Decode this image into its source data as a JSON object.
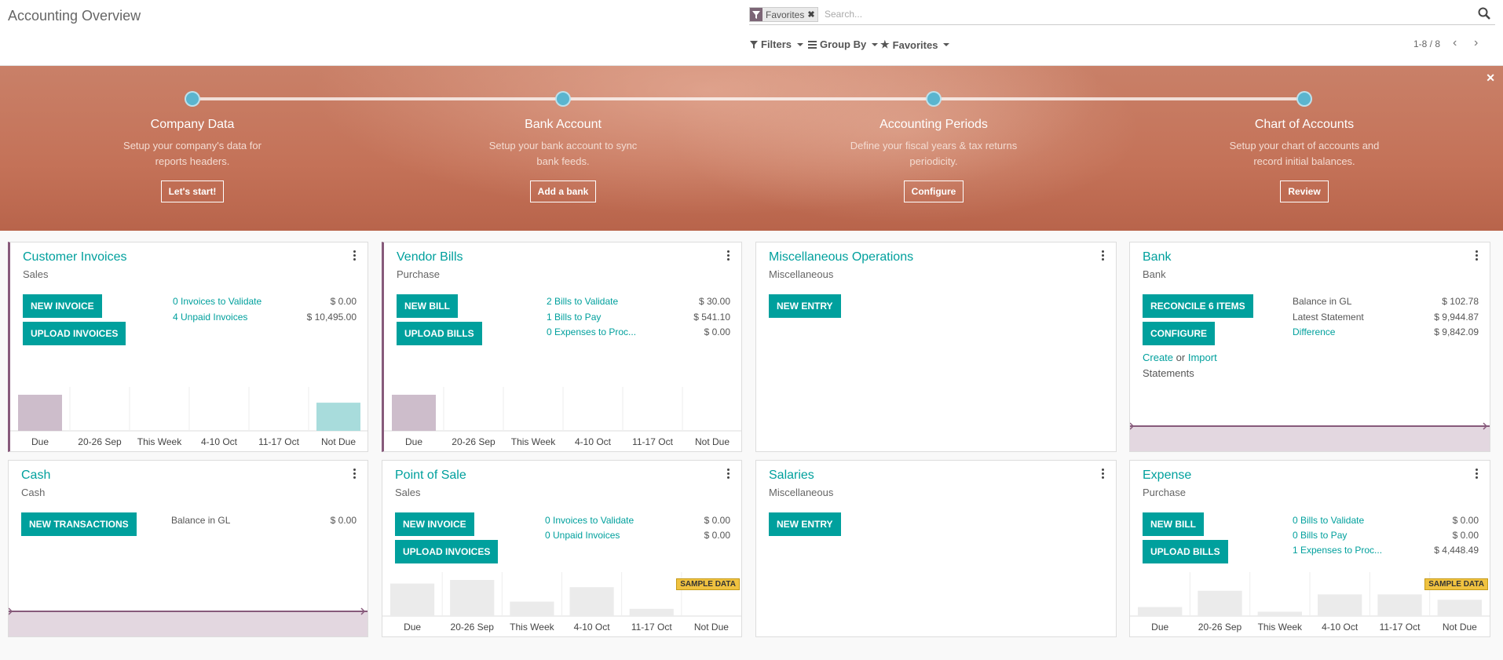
{
  "header": {
    "title": "Accounting Overview",
    "facet_label": "Favorites",
    "search_placeholder": "Search...",
    "filters": "Filters",
    "group_by": "Group By",
    "favorites": "Favorites",
    "pager": "1-8 / 8"
  },
  "onboarding": {
    "steps": [
      {
        "title": "Company Data",
        "desc": "Setup your company's data for reports headers.",
        "button": "Let's start!"
      },
      {
        "title": "Bank Account",
        "desc": "Setup your bank account to sync bank feeds.",
        "button": "Add a bank"
      },
      {
        "title": "Accounting Periods",
        "desc": "Define your fiscal years & tax returns periodicity.",
        "button": "Configure"
      },
      {
        "title": "Chart of Accounts",
        "desc": "Setup your chart of accounts and record initial balances.",
        "button": "Review"
      }
    ]
  },
  "cards": {
    "customer_invoices": {
      "title": "Customer Invoices",
      "subtitle": "Sales",
      "btn1": "NEW INVOICE",
      "btn2": "UPLOAD INVOICES",
      "row1_label": "0 Invoices to Validate",
      "row1_value": "$ 0.00",
      "row2_label": "4 Unpaid Invoices",
      "row2_value": "$ 10,495.00"
    },
    "vendor_bills": {
      "title": "Vendor Bills",
      "subtitle": "Purchase",
      "btn1": "NEW BILL",
      "btn2": "UPLOAD BILLS",
      "row1_label": "2 Bills to Validate",
      "row1_value": "$ 30.00",
      "row2_label": "1 Bills to Pay",
      "row2_value": "$ 541.10",
      "row3_label": "0 Expenses to Proc...",
      "row3_value": "$ 0.00"
    },
    "misc": {
      "title": "Miscellaneous Operations",
      "subtitle": "Miscellaneous",
      "btn1": "NEW ENTRY"
    },
    "bank": {
      "title": "Bank",
      "subtitle": "Bank",
      "btn1": "RECONCILE 6 ITEMS",
      "btn2": "CONFIGURE",
      "row1_label": "Balance in GL",
      "row1_value": "$ 102.78",
      "row2_label": "Latest Statement",
      "row2_value": "$ 9,944.87",
      "row3_label": "Difference",
      "row3_value": "$ 9,842.09",
      "create": "Create",
      "or": "or",
      "import": "Import",
      "statements": "Statements"
    },
    "cash": {
      "title": "Cash",
      "subtitle": "Cash",
      "btn1": "NEW TRANSACTIONS",
      "row1_label": "Balance in GL",
      "row1_value": "$ 0.00"
    },
    "pos": {
      "title": "Point of Sale",
      "subtitle": "Sales",
      "btn1": "NEW INVOICE",
      "btn2": "UPLOAD INVOICES",
      "row1_label": "0 Invoices to Validate",
      "row1_value": "$ 0.00",
      "row2_label": "0 Unpaid Invoices",
      "row2_value": "$ 0.00",
      "sample": "SAMPLE DATA"
    },
    "salaries": {
      "title": "Salaries",
      "subtitle": "Miscellaneous",
      "btn1": "NEW ENTRY"
    },
    "expense": {
      "title": "Expense",
      "subtitle": "Purchase",
      "btn1": "NEW BILL",
      "btn2": "UPLOAD BILLS",
      "row1_label": "0 Bills to Validate",
      "row1_value": "$ 0.00",
      "row2_label": "0 Bills to Pay",
      "row2_value": "$ 0.00",
      "row3_label": "1 Expenses to Proc...",
      "row3_value": "$ 4,448.49",
      "sample": "SAMPLE DATA"
    }
  },
  "chart_data": [
    {
      "type": "bar",
      "card": "customer_invoices",
      "categories": [
        "Due",
        "20-26 Sep",
        "This Week",
        "4-10 Oct",
        "11-17 Oct",
        "Not Due"
      ],
      "values": [
        1.0,
        0,
        0,
        0,
        0,
        0.78
      ],
      "colors": [
        "#cdbdcb",
        "#cdbdcb",
        "#cdbdcb",
        "#cdbdcb",
        "#cdbdcb",
        "#a8dcdc"
      ]
    },
    {
      "type": "bar",
      "card": "vendor_bills",
      "categories": [
        "Due",
        "20-26 Sep",
        "This Week",
        "4-10 Oct",
        "11-17 Oct",
        "Not Due"
      ],
      "values": [
        1.0,
        0,
        0,
        0,
        0,
        0
      ],
      "colors": [
        "#cdbdcb",
        "#cdbdcb",
        "#cdbdcb",
        "#cdbdcb",
        "#cdbdcb",
        "#a8dcdc"
      ]
    },
    {
      "type": "bar",
      "card": "pos",
      "categories": [
        "Due",
        "20-26 Sep",
        "This Week",
        "4-10 Oct",
        "11-17 Oct",
        "Not Due"
      ],
      "values": [
        0.9,
        1.0,
        0.4,
        0.8,
        0.2,
        0
      ],
      "colors": [
        "#ebebeb",
        "#ebebeb",
        "#ebebeb",
        "#ebebeb",
        "#ebebeb",
        "#ebebeb"
      ]
    },
    {
      "type": "bar",
      "card": "expense",
      "categories": [
        "Due",
        "20-26 Sep",
        "This Week",
        "4-10 Oct",
        "11-17 Oct",
        "Not Due"
      ],
      "values": [
        0.25,
        0.7,
        0.12,
        0.6,
        0.6,
        0.45
      ],
      "colors": [
        "#ebebeb",
        "#ebebeb",
        "#ebebeb",
        "#ebebeb",
        "#ebebeb",
        "#ebebeb"
      ]
    },
    {
      "type": "area",
      "card": "bank",
      "values": [
        1,
        1
      ]
    },
    {
      "type": "area",
      "card": "cash",
      "values": [
        1,
        1
      ]
    }
  ]
}
